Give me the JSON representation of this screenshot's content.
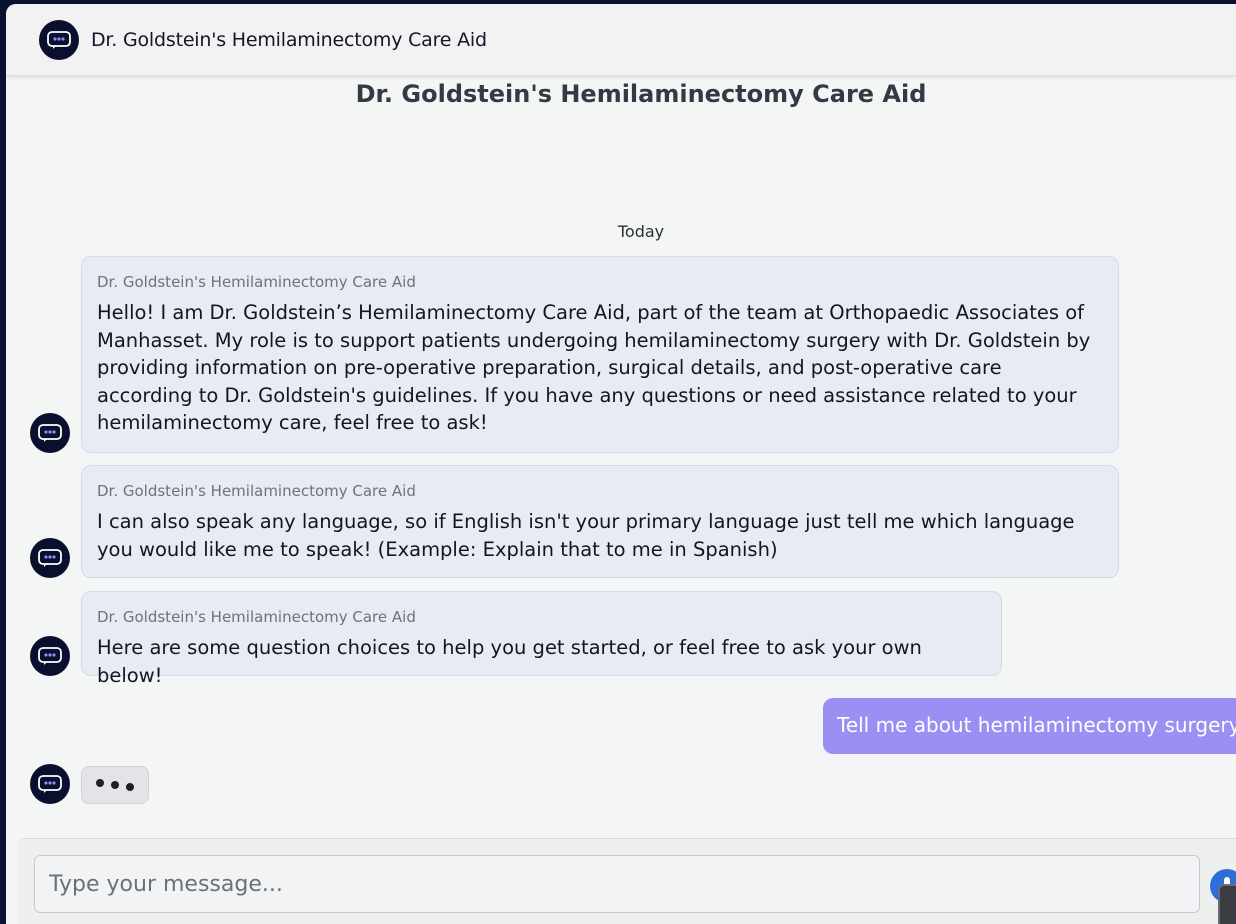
{
  "header": {
    "title": "Dr. Goldstein's Hemilaminectomy Care Aid",
    "avatar_icon": "chatbot-icon"
  },
  "page_title": "Dr. Goldstein's Hemilaminectomy Care Aid",
  "day_label": "Today",
  "messages": [
    {
      "sender": "Dr. Goldstein's Hemilaminectomy Care Aid",
      "text": "Hello! I am Dr. Goldstein’s Hemilaminectomy Care Aid, part of the team at Orthopaedic Associates of Manhasset. My role is to support patients undergoing hemilaminectomy surgery with Dr. Goldstein by providing information on pre-operative preparation, surgical details, and post-operative care according to Dr. Goldstein's guidelines. If you have any questions or need assistance related to your hemilaminectomy care, feel free to ask!"
    },
    {
      "sender": "Dr. Goldstein's Hemilaminectomy Care Aid",
      "text": "I can also speak any language, so if English isn't your primary language just tell me which language you would like me to speak! (Example: Explain that to me in Spanish)"
    },
    {
      "sender": "Dr. Goldstein's Hemilaminectomy Care Aid",
      "text": "Here are some question choices to help you get started, or feel free to ask your own below!"
    }
  ],
  "user_message": "Tell me about hemilaminectomy surgery",
  "composer": {
    "placeholder": "Type your message...",
    "mic_icon": "microphone-icon"
  },
  "colors": {
    "bot_bubble": "#e7ebf3",
    "user_bubble": "#9b8ff4",
    "avatar": "#0b0f2e",
    "mic": "#2f6ed8"
  }
}
